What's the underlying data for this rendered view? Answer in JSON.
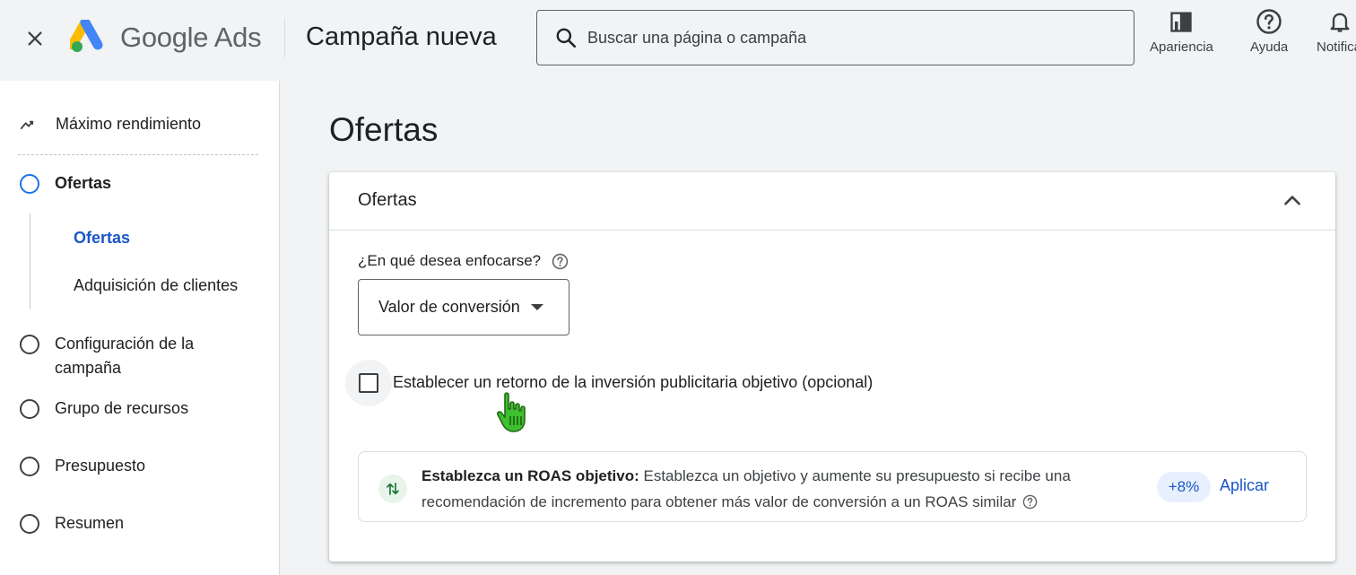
{
  "header": {
    "brand_google": "Google",
    "brand_ads": "Ads",
    "title": "Campaña nueva",
    "search_placeholder": "Buscar una página o campaña",
    "actions": [
      {
        "label": "Apariencia",
        "icon": "appearance-icon"
      },
      {
        "label": "Ayuda",
        "icon": "help-icon"
      },
      {
        "label": "Notificaciones",
        "icon": "bell-icon"
      }
    ]
  },
  "sidebar": {
    "campaign_type": "Máximo rendimiento",
    "steps": [
      {
        "label": "Ofertas",
        "active": true
      },
      {
        "label": "Configuración de la campaña"
      },
      {
        "label": "Grupo de recursos"
      },
      {
        "label": "Presupuesto"
      },
      {
        "label": "Resumen"
      }
    ],
    "substeps": [
      {
        "label": "Ofertas",
        "active": true
      },
      {
        "label": "Adquisición de clientes"
      }
    ]
  },
  "main": {
    "title": "Ofertas",
    "card": {
      "title": "Ofertas",
      "focus_question": "¿En qué desea enfocarse?",
      "focus_value": "Valor de conversión",
      "roas_checkbox_label": "Establecer un retorno de la inversión publicitaria objetivo (opcional)",
      "roas_checked": false,
      "recommendation": {
        "title": "Establezca un ROAS objetivo:",
        "body": "Establezca un objetivo y aumente su presupuesto si recibe una recomendación de incremento para obtener más valor de conversión a un ROAS similar",
        "badge": "+8%",
        "action": "Aplicar"
      }
    }
  },
  "colors": {
    "accent": "#1a73e8",
    "link": "#1a56c7",
    "background": "#f1f3f4",
    "positive": "#137333"
  }
}
